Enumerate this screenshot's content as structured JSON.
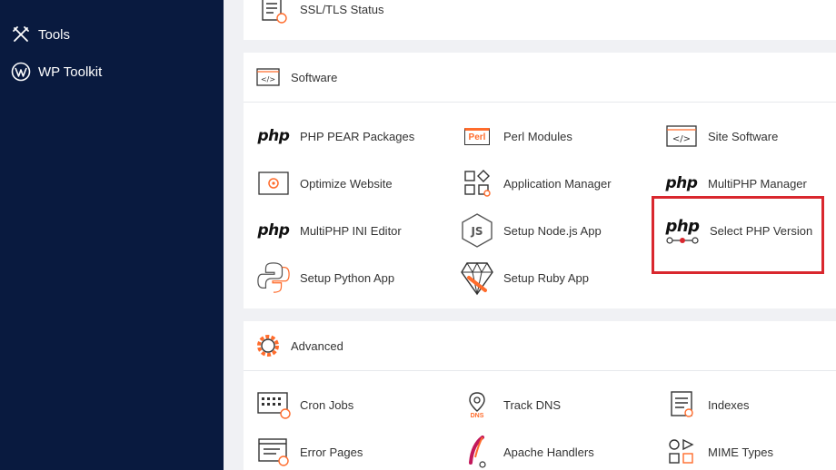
{
  "sidebar": {
    "items": [
      {
        "label": "Tools",
        "icon": "tools-icon"
      },
      {
        "label": "WP Toolkit",
        "icon": "wordpress-icon"
      }
    ]
  },
  "top_panel": {
    "item": {
      "label": "SSL/TLS Status",
      "icon": "ssl-status-icon"
    }
  },
  "software": {
    "title": "Software",
    "items": [
      {
        "label": "PHP PEAR Packages",
        "icon": "php-pear-icon"
      },
      {
        "label": "Perl Modules",
        "icon": "perl-icon",
        "badge": "Perl"
      },
      {
        "label": "Site Software",
        "icon": "code-icon"
      },
      {
        "label": "Optimize Website",
        "icon": "optimize-icon"
      },
      {
        "label": "Application Manager",
        "icon": "app-manager-icon"
      },
      {
        "label": "MultiPHP Manager",
        "icon": "multiphp-manager-icon"
      },
      {
        "label": "MultiPHP INI Editor",
        "icon": "multiphp-ini-icon"
      },
      {
        "label": "Setup Node.js App",
        "icon": "nodejs-icon",
        "badge": "JS"
      },
      {
        "label": "Select PHP Version",
        "icon": "select-php-icon"
      },
      {
        "label": "Setup Python App",
        "icon": "python-icon"
      },
      {
        "label": "Setup Ruby App",
        "icon": "ruby-icon"
      }
    ]
  },
  "advanced": {
    "title": "Advanced",
    "items": [
      {
        "label": "Cron Jobs",
        "icon": "cron-icon"
      },
      {
        "label": "Track DNS",
        "icon": "track-dns-icon",
        "badge": "DNS"
      },
      {
        "label": "Indexes",
        "icon": "indexes-icon"
      },
      {
        "label": "Error Pages",
        "icon": "error-pages-icon"
      },
      {
        "label": "Apache Handlers",
        "icon": "apache-icon"
      },
      {
        "label": "MIME Types",
        "icon": "mime-icon"
      }
    ]
  },
  "php_logo_text": "php",
  "colors": {
    "sidebar": "#091a3f",
    "accent": "#ff6c2c",
    "highlight": "#d9272e"
  }
}
